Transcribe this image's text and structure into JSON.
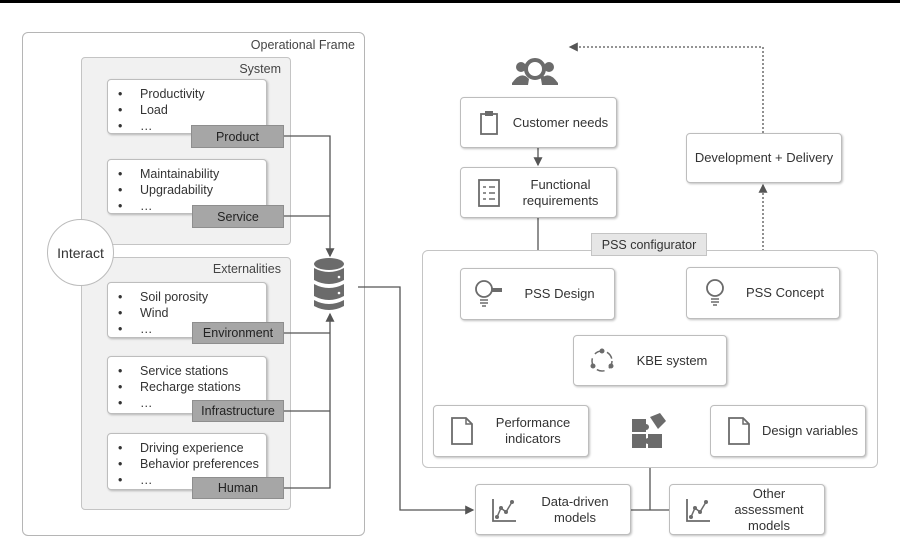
{
  "operational_frame": {
    "title": "Operational Frame",
    "system": {
      "title": "System",
      "product": {
        "items": [
          "Productivity",
          "Load",
          "…"
        ],
        "tag": "Product"
      },
      "service": {
        "items": [
          "Maintainability",
          "Upgradability",
          "…"
        ],
        "tag": "Service"
      }
    },
    "interact": "Interact",
    "externalities": {
      "title": "Externalities",
      "environment": {
        "items": [
          "Soil porosity",
          "Wind",
          "…"
        ],
        "tag": "Environment"
      },
      "infrastructure": {
        "items": [
          "Service stations",
          "Recharge stations",
          "…"
        ],
        "tag": "Infrastructure"
      },
      "human": {
        "items": [
          "Driving experience",
          "Behavior preferences",
          "…"
        ],
        "tag": "Human"
      }
    }
  },
  "flow": {
    "customer_needs": "Customer needs",
    "functional_requirements": "Functional requirements",
    "development_delivery": "Development + Delivery"
  },
  "pss_configurator": {
    "title": "PSS configurator",
    "pss_design": "PSS Design",
    "pss_concept": "PSS Concept",
    "kbe_system": "KBE system",
    "performance_indicators": "Performance indicators",
    "design_variables": "Design variables"
  },
  "models": {
    "data_driven": "Data-driven models",
    "other_assessment": "Other assessment models"
  },
  "colors": {
    "icon": "#6b6b6b",
    "tag": "#a6a6a6",
    "group": "#f1f1f1"
  }
}
